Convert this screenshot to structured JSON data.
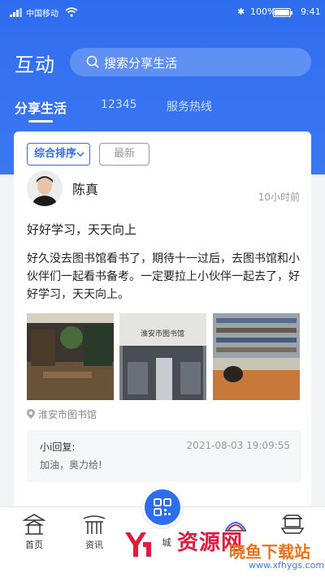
{
  "status_bar": {
    "carrier": "中国移动",
    "battery": "100%",
    "time": "9:41"
  },
  "header": {
    "title": "互动",
    "search_placeholder": "搜索分享生活"
  },
  "tabs": [
    "分享生活",
    "12345",
    "服务热线"
  ],
  "filters": {
    "sort_label": "综合排序",
    "latest_label": "最新"
  },
  "post": {
    "author": "陈真",
    "time_ago": "10小时前",
    "title": "好好学习，天天向上",
    "body": "好久没去图书馆看书了，期待十一过后，去图书馆和小伙伴们一起看书备考。一定要拉上小伙伴一起去了，好好学习，天天向上。",
    "photo_sign": "淮安市图书馆",
    "location": "淮安市图书馆",
    "reply": {
      "label": "小i回复:",
      "date": "2021-08-03  19:09:55",
      "text": "加油，奥力给!"
    }
  },
  "tabbar": {
    "items": [
      "首页",
      "资讯"
    ],
    "center_label": "城"
  },
  "watermark": {
    "text": "资源网",
    "site": "晓鱼下载站",
    "url": "www.xfhygs.com"
  },
  "colors": {
    "primary": "#2f6df0",
    "text": "#222222",
    "muted": "#999999"
  }
}
